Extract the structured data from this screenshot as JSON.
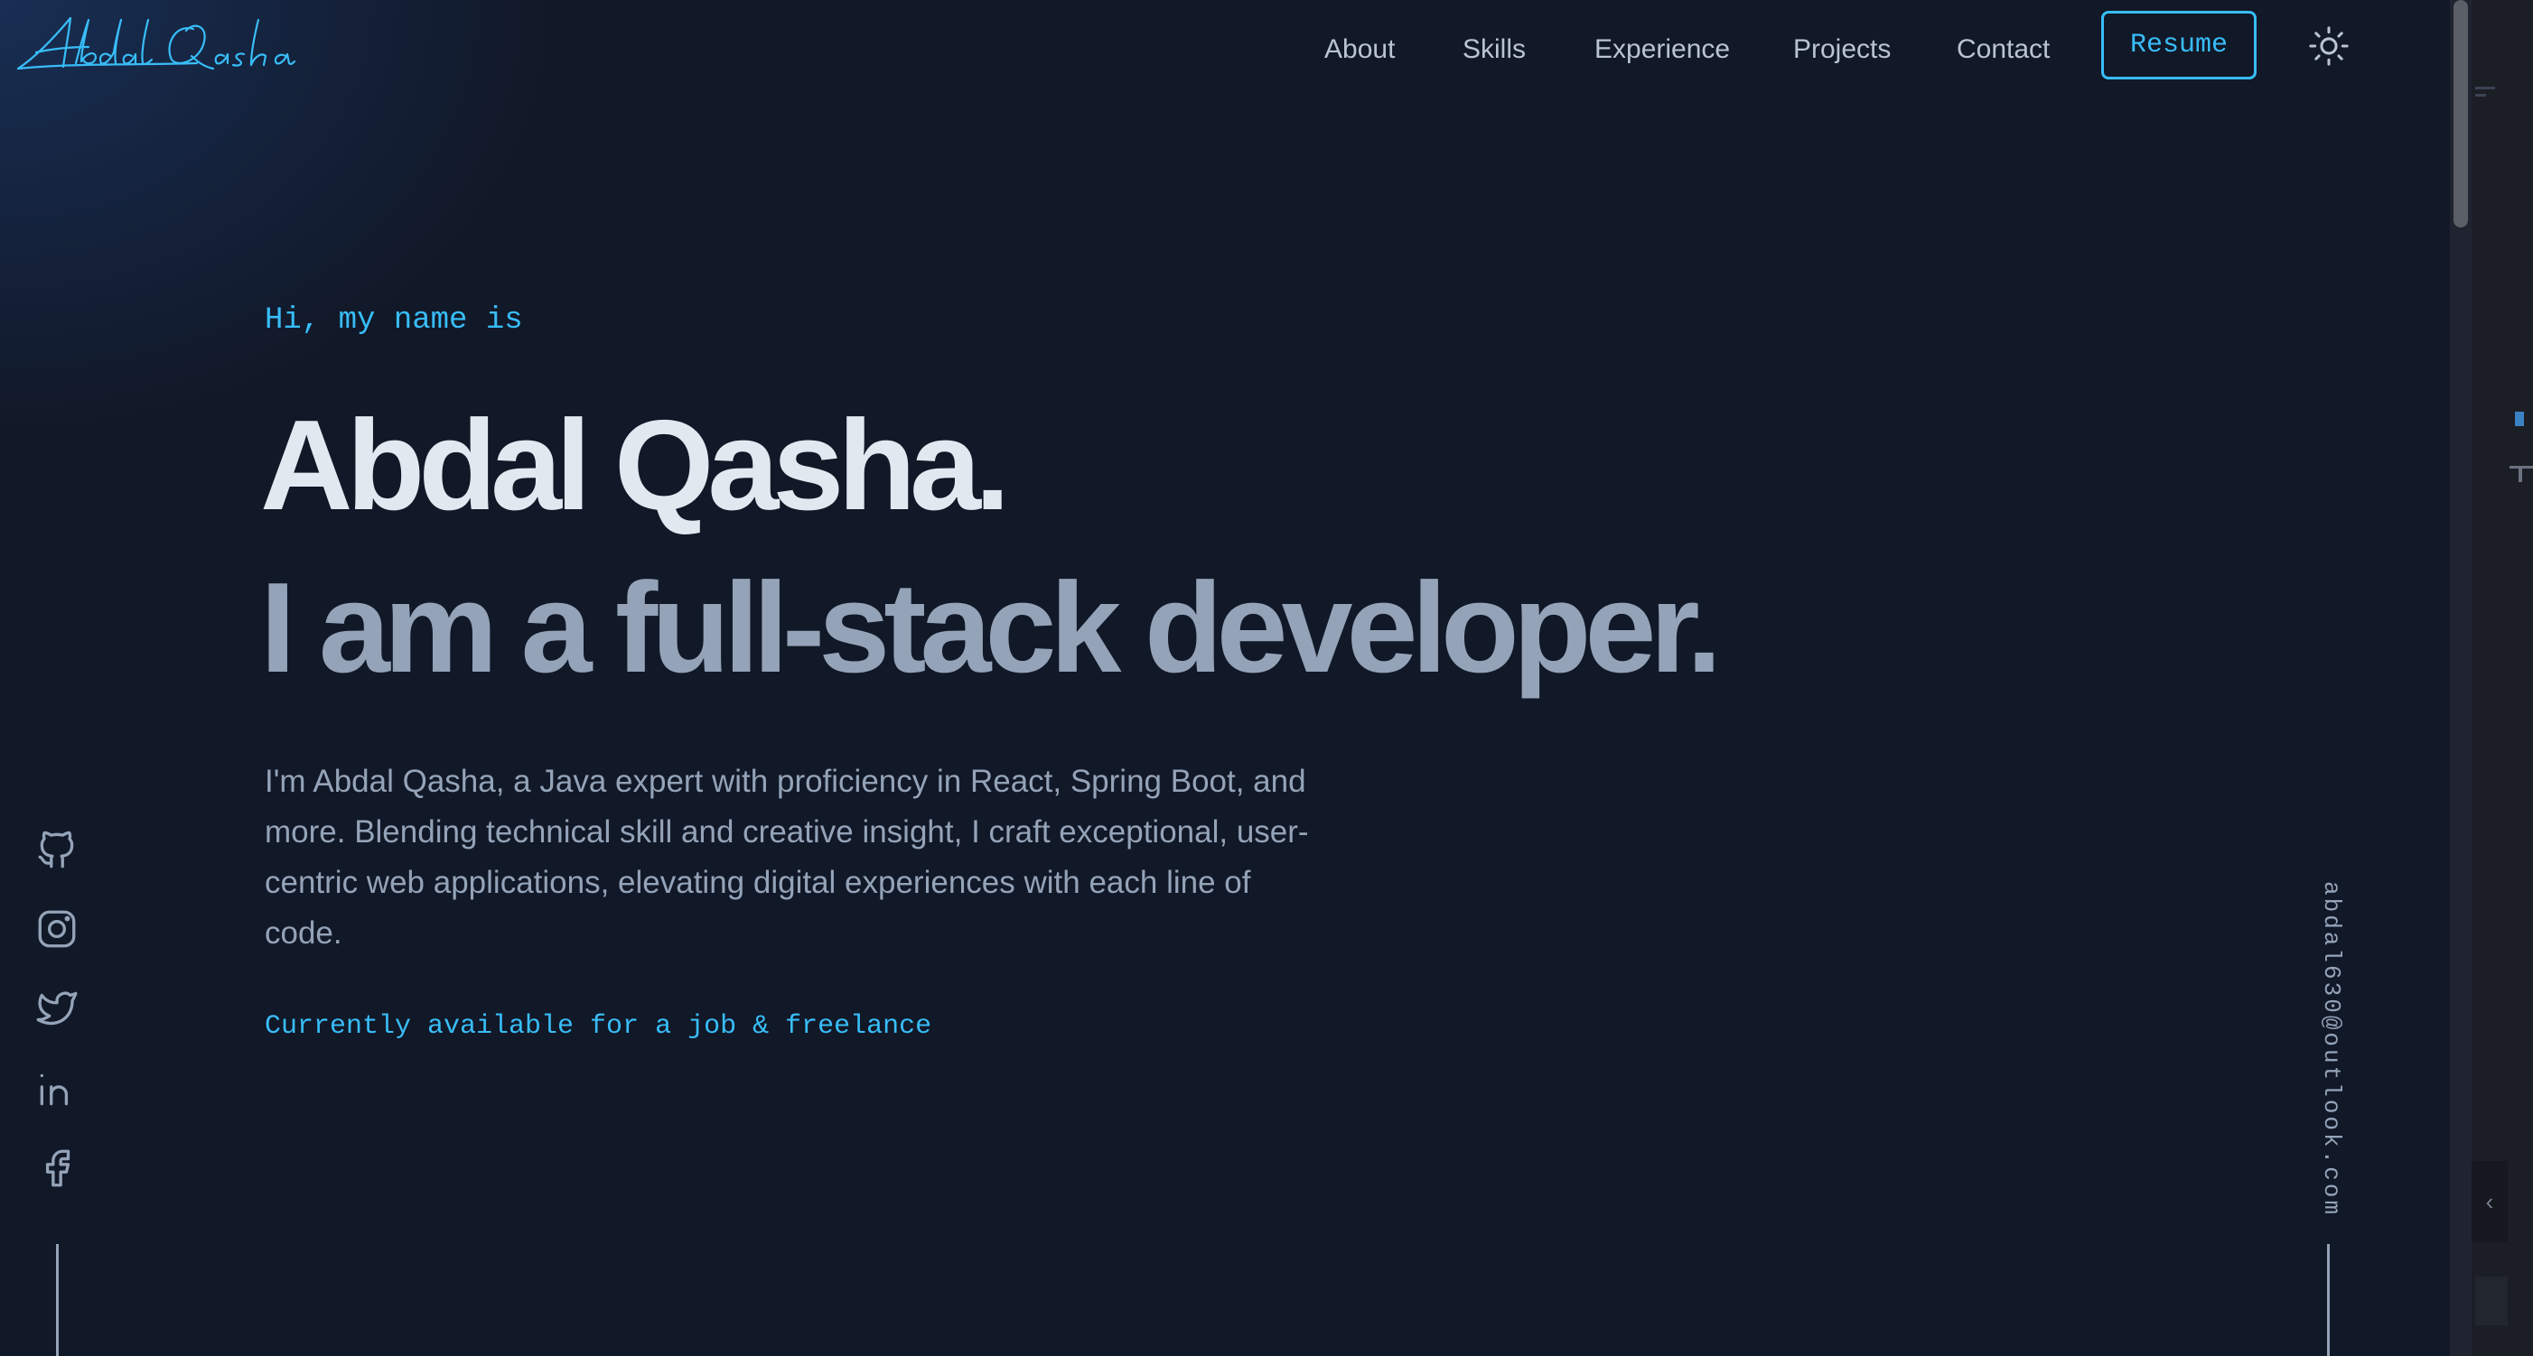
{
  "header": {
    "logo_text": "Abdal Qasha",
    "nav_items": [
      {
        "label": "About"
      },
      {
        "label": "Skills"
      },
      {
        "label": "Experience"
      },
      {
        "label": "Projects"
      },
      {
        "label": "Contact"
      }
    ],
    "resume_label": "Resume",
    "theme_toggle_icon": "sun-icon"
  },
  "hero": {
    "greeting": "Hi, my name is",
    "name": "Abdal Qasha.",
    "role": "I am a full-stack developer.",
    "description": "I'm Abdal Qasha, a Java expert with proficiency in React, Spring Boot, and more. Blending technical skill and creative insight, I craft exceptional, user-centric web applications, elevating digital experiences with each line of code.",
    "availability": "Currently available for a job & freelance"
  },
  "socials": [
    {
      "name": "github",
      "icon": "github-icon"
    },
    {
      "name": "instagram",
      "icon": "instagram-icon"
    },
    {
      "name": "twitter",
      "icon": "twitter-icon"
    },
    {
      "name": "linkedin",
      "icon": "linkedin-icon"
    },
    {
      "name": "facebook",
      "icon": "facebook-icon"
    }
  ],
  "email": "abdal630@outlook.com",
  "side_panel": {
    "collapse_icon": "chevron-left-icon",
    "collapse_glyph": "‹"
  },
  "colors": {
    "background": "#111827",
    "accent": "#38bdf8",
    "heading": "#e2e8f0",
    "muted": "#94a3b8"
  }
}
